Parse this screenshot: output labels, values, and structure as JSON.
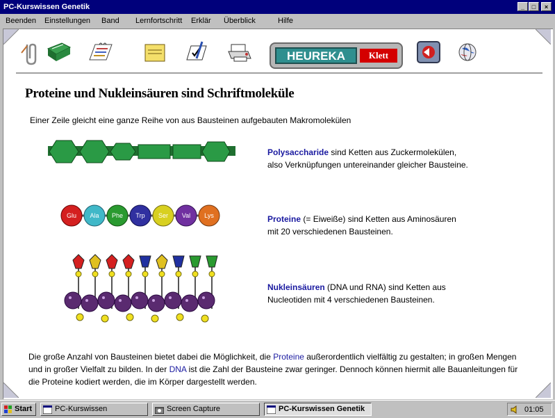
{
  "window": {
    "title": "PC-Kurswissen Genetik",
    "min_label": "_",
    "max_label": "□",
    "close_label": "×"
  },
  "menu": [
    "Beenden",
    "Einstellungen",
    "Band",
    "Lernfortschritt",
    "Erklär",
    "Überblick",
    "Hilfe"
  ],
  "toolbar": {
    "icons": [
      "paperclip-icon",
      "book-icon",
      "notebook-icon",
      "notepad-icon",
      "quiz-icon",
      "printer-icon",
      "back-arrow-icon",
      "globe-icon"
    ],
    "logo_main": "HEUREKA",
    "logo_sub": "Klett"
  },
  "content": {
    "title": "Proteine und Nukleinsäuren sind Schriftmoleküle",
    "intro": "Einer Zeile gleicht eine ganze Reihe von aus Bausteinen aufgebauten Makromolekülen",
    "items": [
      {
        "term": "Polysaccharide",
        "line1": "sind Ketten aus Zuckermolekülen,",
        "line2": "also Verknüpfungen untereinander gleicher Bausteine."
      },
      {
        "term": "Proteine",
        "line1": "(= Eiweiße) sind Ketten aus Aminosäuren",
        "line2": "mit 20 verschiedenen Bausteinen."
      },
      {
        "term": "Nukleinsäuren",
        "line1": "(DNA und RNA) sind Ketten aus",
        "line2": "Nucleotiden mit 4 verschiedenen Bausteinen."
      }
    ],
    "amino_labels": [
      "Glu",
      "Ala",
      "Phe",
      "Trp",
      "Ser",
      "Val",
      "Lys"
    ],
    "paragraph_start": "Die große Anzahl von Bausteinen bietet dabei die Möglichkeit, die ",
    "paragraph_link": "Proteine",
    "paragraph_mid": " außerordentlich vielfältig zu gestalten; in großen Mengen und in großer Vielfalt zu bilden. In der ",
    "paragraph_link2": "DNA",
    "paragraph_end": " ist die Zahl der Bausteine zwar geringer. Dennoch können hiermit alle Bauanleitungen für die Proteine kodiert werden, die im Körper dargestellt werden."
  },
  "taskbar": {
    "start_label": "Start",
    "tasks": [
      "PC-Kurswissen",
      "Screen Capture",
      "PC-Kurswissen Genetik"
    ],
    "clock": "01:05"
  },
  "colors": {
    "titlebar": "#00007b",
    "link": "#1a1aa0",
    "polysaccharide": "#1f8f3a",
    "logo_red": "#d40000"
  }
}
